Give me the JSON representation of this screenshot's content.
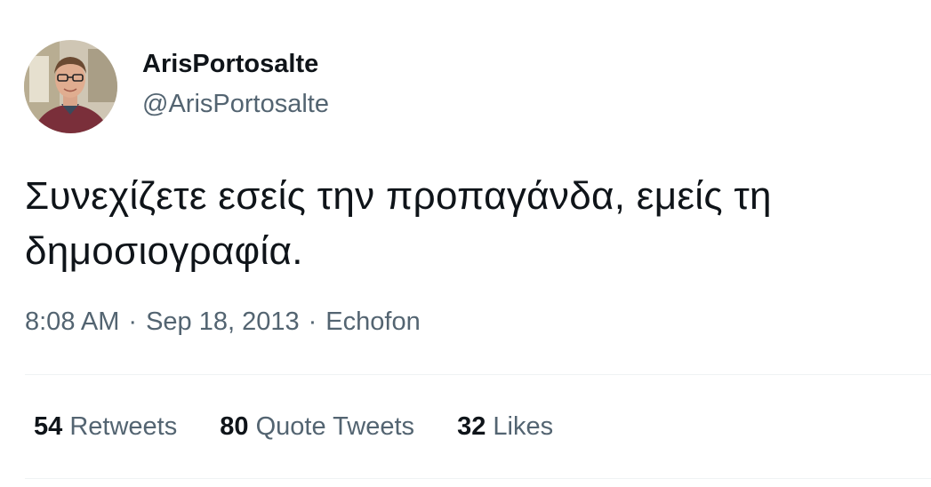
{
  "author": {
    "display_name": "ArisPortosalte",
    "handle": "@ArisPortosalte"
  },
  "tweet": {
    "text": "Συνεχίζετε εσείς την προπαγάνδα, εμείς τη δημοσιογραφία.",
    "time": "8:08 AM",
    "date": "Sep 18, 2013",
    "source": "Echofon",
    "separator": "·"
  },
  "stats": {
    "retweets": {
      "count": "54",
      "label": "Retweets"
    },
    "quote_tweets": {
      "count": "80",
      "label": "Quote Tweets"
    },
    "likes": {
      "count": "32",
      "label": "Likes"
    }
  },
  "colors": {
    "primary_text": "#0f1419",
    "secondary_text": "#536471",
    "divider": "#eff3f4"
  }
}
